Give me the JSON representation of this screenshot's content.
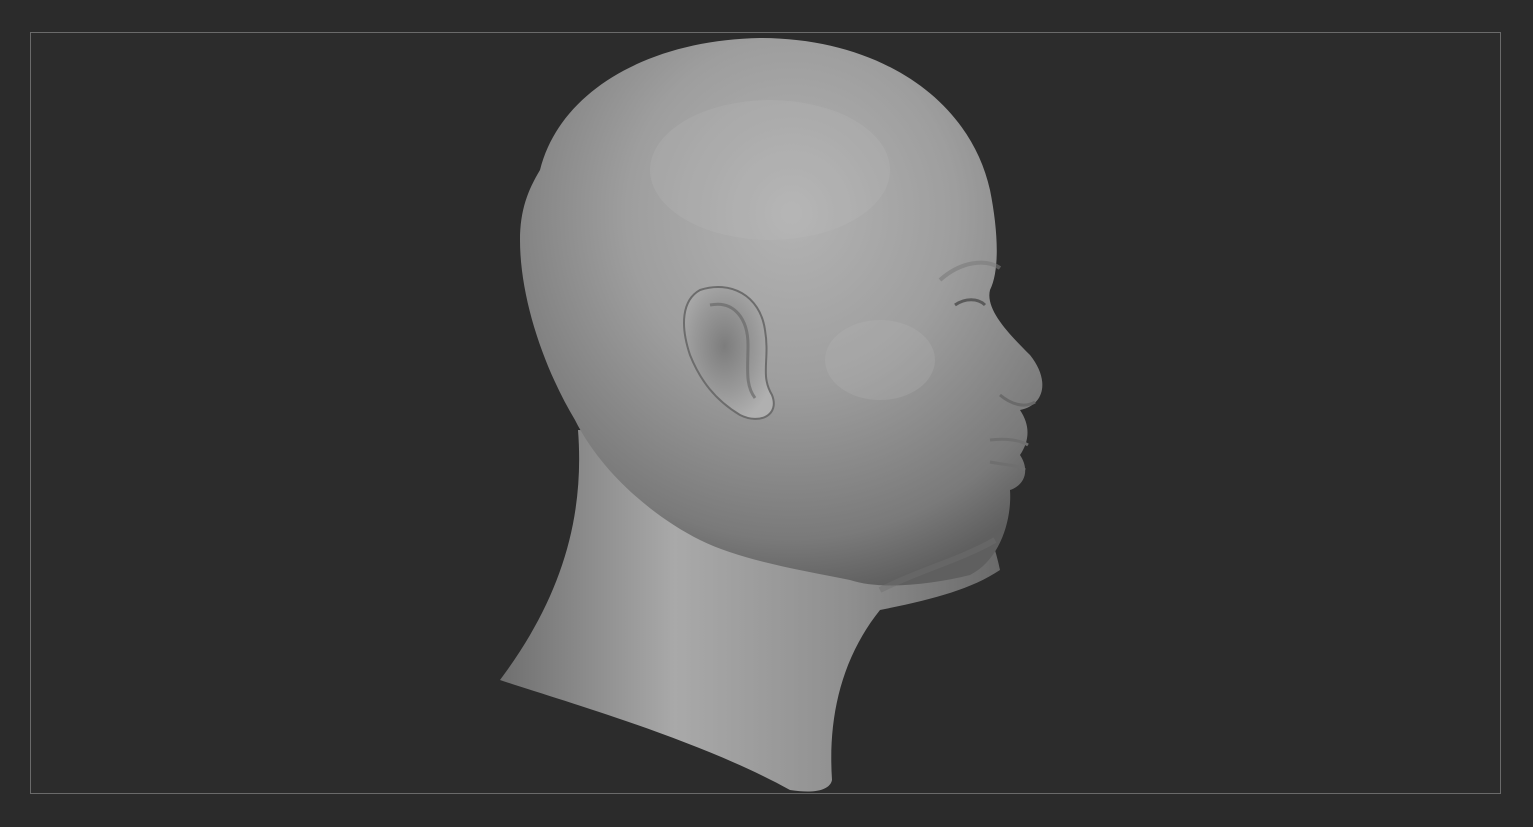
{
  "viewport": {
    "background_color": "#2b2b2b",
    "frame_color": "#6a6a6a",
    "model": {
      "subject": "bald-male-head",
      "view": "right-profile",
      "material_color": "#9a9a9a"
    }
  }
}
